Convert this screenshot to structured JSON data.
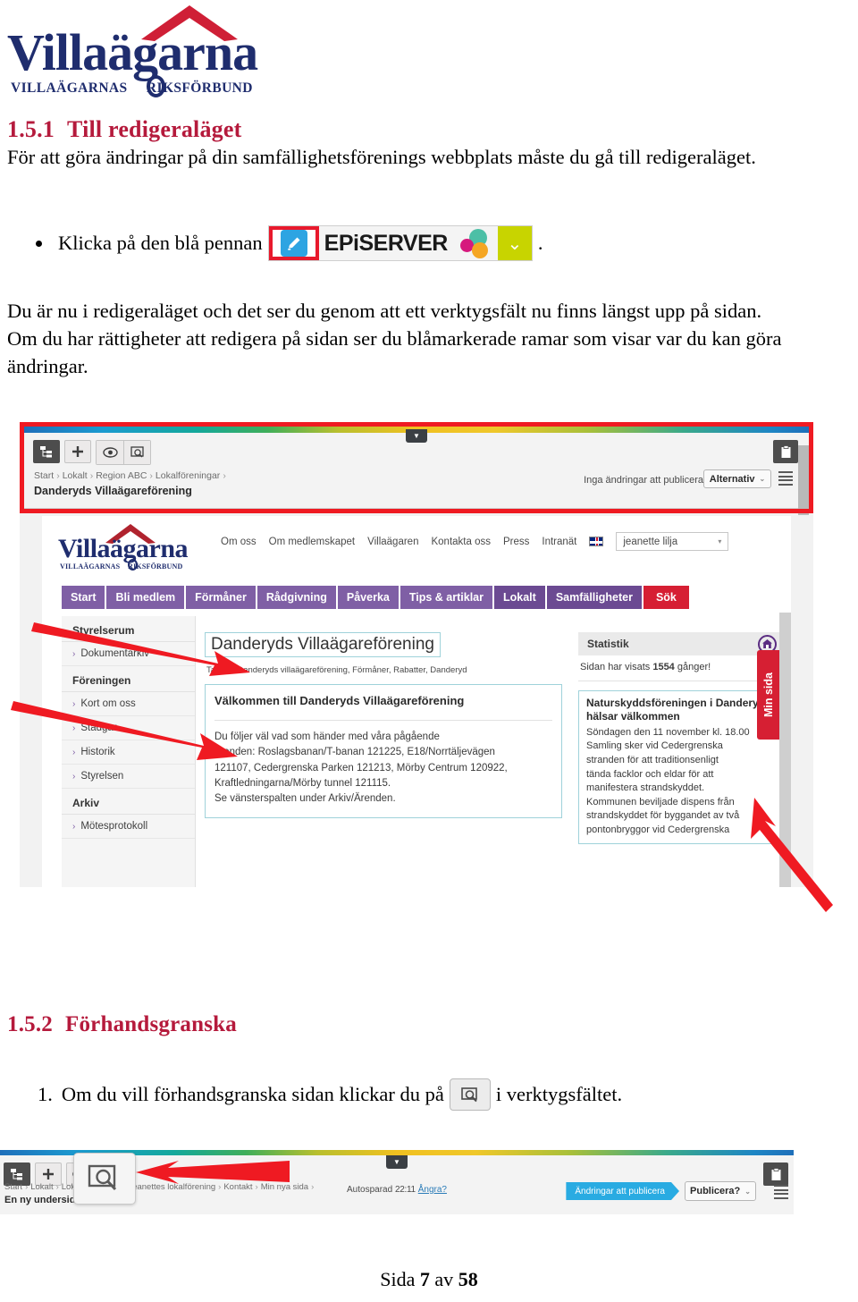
{
  "logo": {
    "name": "Villaägarna",
    "subtitle_left": "VILLAÄGARNAS",
    "subtitle_right": "RIKSFÖRBUND",
    "roof_color": "#cf1f36",
    "text_color": "#1f2d6e"
  },
  "section1": {
    "number": "1.5.1",
    "title": "Till redigeraläget",
    "paragraph1": "För att göra ändringar på din samfällighetsförenings webbplats måste du gå till redigeraläget.",
    "bullet": "Klicka på den blå pennan",
    "bullet_trailing": ".",
    "paragraph2": "Du är nu i redigeraläget och det ser du genom att ett verktygsfält nu finns längst upp på sidan.  Om du har rättigheter att redigera på sidan ser du blåmarkerade ramar som visar var du kan göra ändringar."
  },
  "epi_chip": {
    "wordmark": "EPiSERVER",
    "pencil_icon": "pencil-icon",
    "chevron_icon": "chevron-down-icon",
    "highlight_color": "#e8192c",
    "pencil_bg": "#2da4e2",
    "chevron_bg": "#c8d400"
  },
  "editor_toolbar": {
    "buttons": [
      {
        "name": "sitemap-icon",
        "label": ""
      },
      {
        "name": "plus-icon",
        "label": ""
      },
      {
        "name": "eye-icon",
        "label": ""
      },
      {
        "name": "preview-icon",
        "label": ""
      }
    ],
    "right_buttons": [
      {
        "name": "clipboard-icon",
        "label": ""
      }
    ],
    "breadcrumb": [
      "Start",
      "Lokalt",
      "Region ABC",
      "Lokalföreningar"
    ],
    "page_name": "Danderyds Villaägareförening",
    "publish_status": "Inga ändringar att publicera",
    "options_label": "Alternativ",
    "toggle_icon": "caret-down-icon",
    "menu_icon": "list-menu-icon"
  },
  "site": {
    "top_links": [
      "Om oss",
      "Om medlemskapet",
      "Villaägaren",
      "Kontakta oss",
      "Press",
      "Intranät"
    ],
    "flag_icon": "uk-flag-icon",
    "user_name": "jeanette lilja",
    "user_chevron": "chevron-down-icon",
    "nav": [
      {
        "label": "Start",
        "active": false
      },
      {
        "label": "Bli medlem",
        "active": false
      },
      {
        "label": "Förmåner",
        "active": false
      },
      {
        "label": "Rådgivning",
        "active": false
      },
      {
        "label": "Påverka",
        "active": false
      },
      {
        "label": "Tips & artiklar",
        "active": false
      },
      {
        "label": "Lokalt",
        "active": true
      },
      {
        "label": "Samfälligheter",
        "active": false
      }
    ],
    "search_label": "Sök",
    "nav_color": "#7f5fa5",
    "nav_active_color": "#6b4a92",
    "search_color": "#d61f33"
  },
  "sidebar": {
    "groups": [
      {
        "heading": "Styrelserum",
        "items": [
          "Dokumentarkiv"
        ]
      },
      {
        "heading": "Föreningen",
        "items": [
          "Kort om oss",
          "Stadgar",
          "Historik",
          "Styrelsen"
        ]
      },
      {
        "heading": "Arkiv",
        "items": [
          "Mötesprotokoll"
        ]
      }
    ]
  },
  "content": {
    "page_title": "Danderyds Villaägareförening",
    "tags_label": "Taggar:",
    "tags": "Danderyds villaägareförening, Förmåner, Rabatter, Danderyd",
    "welcome_heading": "Välkommen till Danderyds Villaägareförening",
    "body_lines": [
      "Du följer väl vad som händer med våra pågående",
      "ärenden: Roslagsbanan/T-banan 121225, E18/Norrtäljevägen",
      "121107, Cedergrenska Parken 121213, Mörby Centrum 120922,",
      "Kraftledningarna/Mörby tunnel 121115.",
      "Se vänsterspalten under Arkiv/Ärenden."
    ]
  },
  "statistics": {
    "heading": "Statistik",
    "house_icon": "house-badge-icon",
    "visits_prefix": "Sidan har visats",
    "visits_count": "1554",
    "visits_suffix": "gånger!"
  },
  "news": {
    "title": "Naturskyddsföreningen i Danderyd hälsar välkommen",
    "lines": [
      "Söndagen den 11 november kl. 18.00",
      "Samling sker vid Cedergrenska",
      "stranden för att traditionsenligt",
      "tända facklor och eldar för att",
      "manifestera strandskyddet.",
      "Kommunen beviljade dispens från",
      "strandskyddet för byggandet av två",
      "pontonbryggor vid Cedergrenska"
    ]
  },
  "min_sida": {
    "label": "Min sida",
    "color": "#d61f33"
  },
  "section2": {
    "number": "1.5.2",
    "title": "Förhandsgranska",
    "step_number": "1.",
    "step_text_before": "Om du vill förhandsgranska sidan klickar du på",
    "step_icon": "preview-icon",
    "step_text_after": "i verktygsfältet."
  },
  "bottom_toolbar": {
    "buttons": [
      {
        "name": "sitemap-icon"
      },
      {
        "name": "plus-icon"
      },
      {
        "name": "eye-icon"
      }
    ],
    "highlighted_icon": "preview-icon",
    "breadcrumb": [
      "Start",
      "Lokalt",
      "Lokalföreningar",
      "Jeanettes lokalförening",
      "Kontakt",
      "Min nya sida"
    ],
    "page_name": "En ny undersida",
    "autosave_label": "Autosparad",
    "autosave_time": "22:11",
    "undo_label": "Ångra?",
    "publish_changes_label": "Ändringar att publicera",
    "publish_label": "Publicera?",
    "publish_color": "#29abe2",
    "clipboard_icon": "clipboard-icon",
    "menu_icon": "list-menu-icon"
  },
  "footer": {
    "page_prefix": "Sida",
    "page_number": "7",
    "page_middle": "av",
    "page_total": "58"
  },
  "annotations": {
    "arrow_color": "#e8192c"
  }
}
